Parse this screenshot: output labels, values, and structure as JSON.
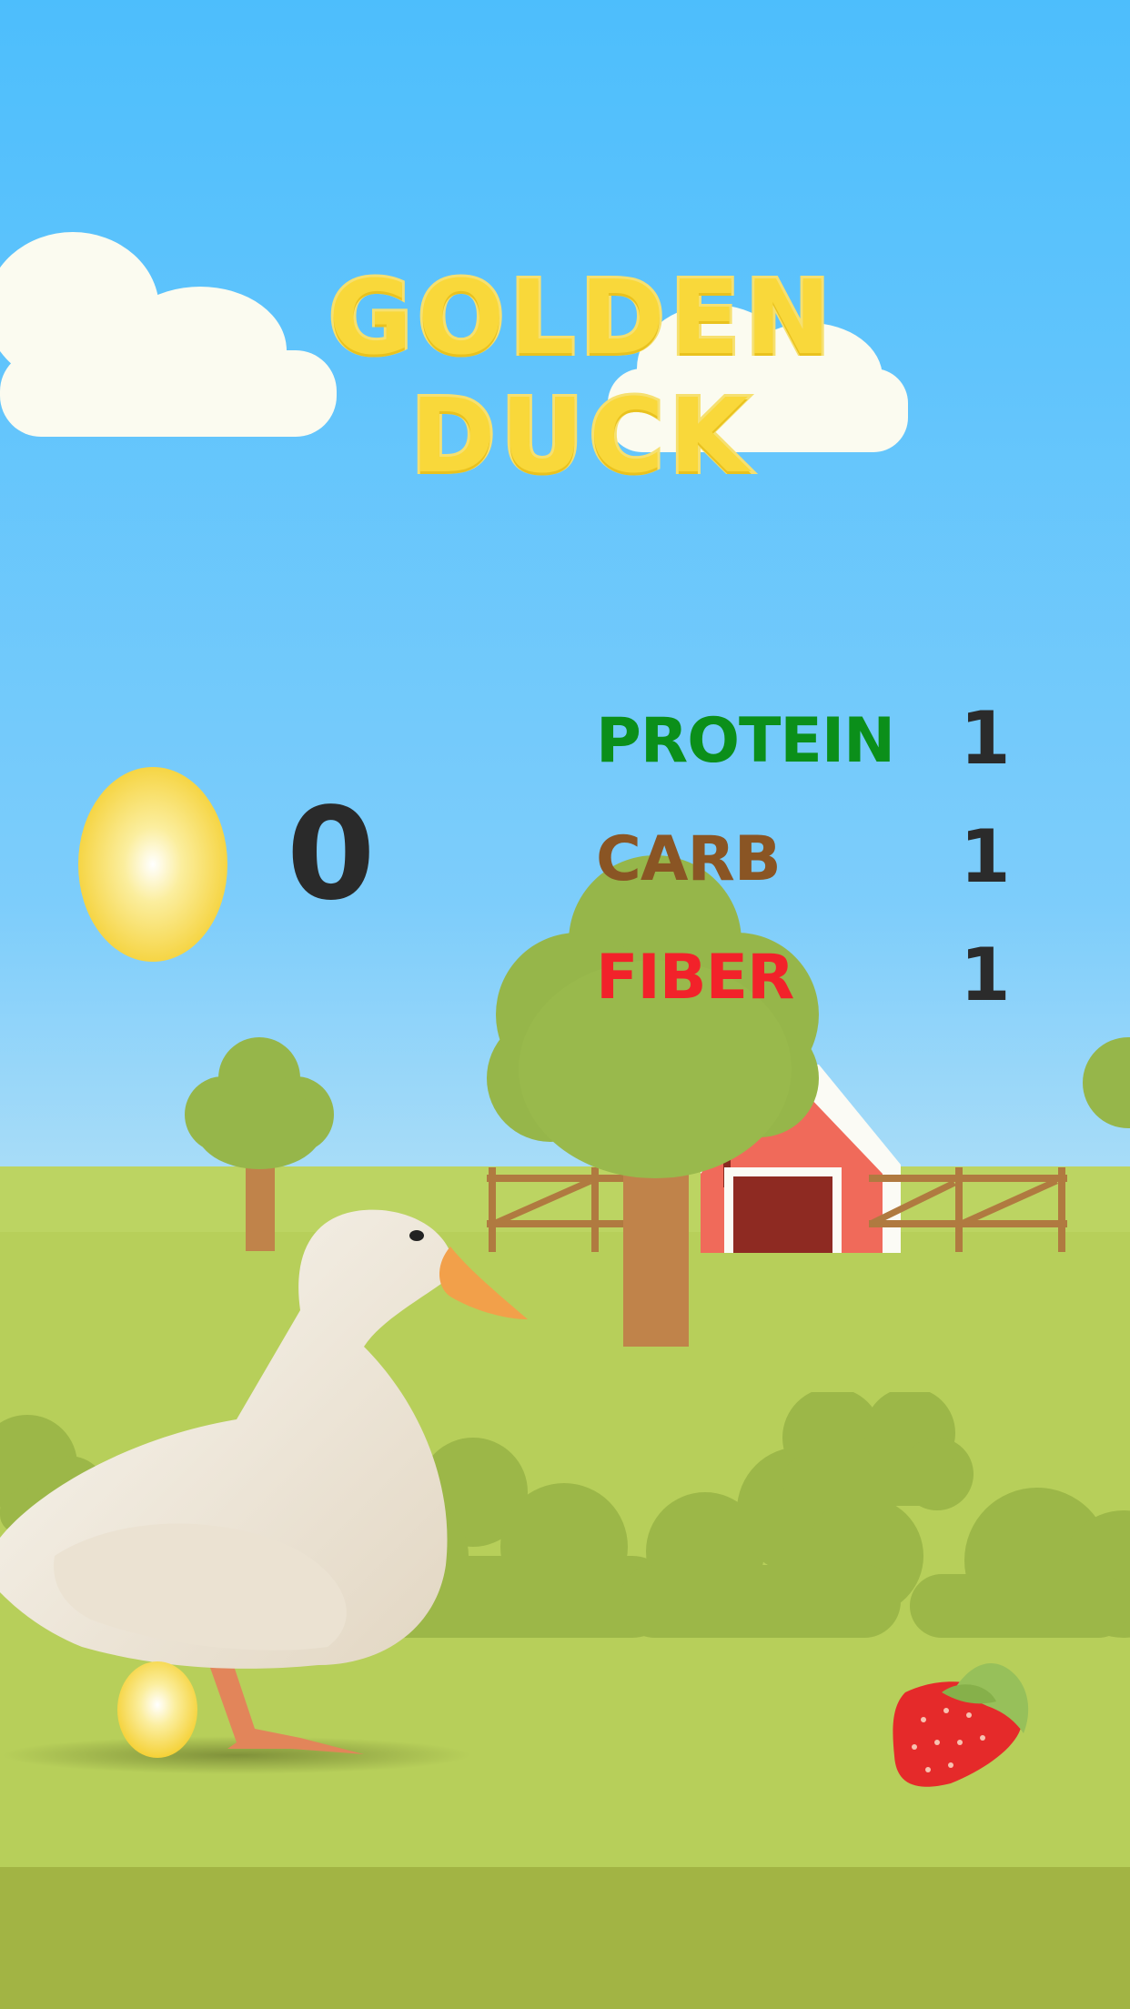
{
  "game": {
    "title": "GOLDEN DUCK",
    "score": "0",
    "stats": [
      {
        "label": "PROTEIN",
        "value": "1",
        "color": "#0b8f1a"
      },
      {
        "label": "CARB",
        "value": "1",
        "color": "#8a5524"
      },
      {
        "label": "FIBER",
        "value": "1",
        "color": "#f2222a"
      }
    ]
  },
  "colors": {
    "sky_top": "#4dbefc",
    "grass": "#b7cf5a",
    "ground_dark": "#a2b444",
    "egg": "#f7d84a",
    "barn": "#f06a5a"
  },
  "icons": [
    "golden-egg-icon",
    "duck-icon",
    "strawberry-icon"
  ]
}
